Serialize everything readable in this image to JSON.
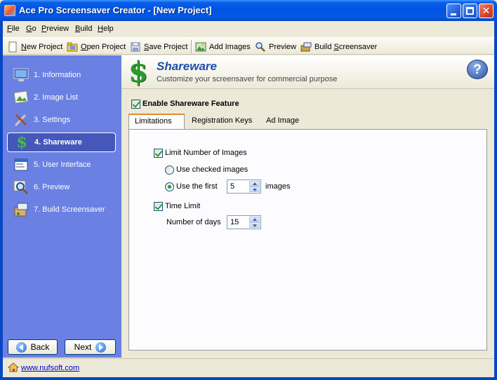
{
  "window": {
    "title": "Ace Pro Screensaver Creator - [New Project]"
  },
  "menu": [
    {
      "accel": "F",
      "rest": "ile"
    },
    {
      "accel": "G",
      "rest": "o"
    },
    {
      "accel": "P",
      "rest": "review"
    },
    {
      "accel": "B",
      "rest": "uild"
    },
    {
      "accel": "H",
      "rest": "elp"
    }
  ],
  "toolbar": {
    "new_project": {
      "accel": "N",
      "rest": "ew Project"
    },
    "open_project": {
      "accel": "O",
      "rest": "pen Project"
    },
    "save_project": {
      "accel": "S",
      "rest": "ave Project"
    },
    "add_images": "Add Images",
    "preview": "Preview",
    "build_screensaver": {
      "pre": "Build ",
      "accel": "S",
      "rest": "creensaver"
    }
  },
  "nav": {
    "items": [
      {
        "label": "1. Information",
        "icon": "monitor-icon"
      },
      {
        "label": "2. Image List",
        "icon": "picture-icon"
      },
      {
        "label": "3. Settings",
        "icon": "tools-icon"
      },
      {
        "label": "4. Shareware",
        "icon": "dollar-icon"
      },
      {
        "label": "5. User Interface",
        "icon": "window-icon"
      },
      {
        "label": "6. Preview",
        "icon": "magnifier-icon"
      },
      {
        "label": "7. Build Screensaver",
        "icon": "build-icon"
      }
    ],
    "active_index": 3,
    "back_label": "Back",
    "next_label": "Next"
  },
  "header": {
    "title": "Shareware",
    "subtitle": "Customize your screensaver for commercial purpose",
    "icon": "dollar-icon",
    "help_glyph": "?"
  },
  "enable_shareware": {
    "label": "Enable Shareware Feature",
    "checked": true
  },
  "tabs": [
    {
      "label": "Limitations",
      "active": true
    },
    {
      "label": "Registration Keys",
      "active": false
    },
    {
      "label": "Ad Image",
      "active": false
    }
  ],
  "limitations": {
    "limit_images": {
      "label": "Limit Number of Images",
      "checked": true
    },
    "use_checked": {
      "label": "Use checked images",
      "selected": false
    },
    "use_first": {
      "label": "Use the first",
      "selected": true,
      "value": "5",
      "suffix": "images"
    },
    "time_limit": {
      "label": "Time Limit",
      "checked": true
    },
    "days": {
      "label": "Number of days",
      "value": "15"
    }
  },
  "status": {
    "link": "www.nufsoft.com",
    "icon": "home-icon"
  },
  "colors": {
    "titlebar": "#0054e3",
    "sidebar": "#6a80e3",
    "sidebar_active": "#4557b8",
    "header_title": "#1d4fa8",
    "dollar": "#2c9a2c",
    "tab_accent": "#e68b2c"
  }
}
